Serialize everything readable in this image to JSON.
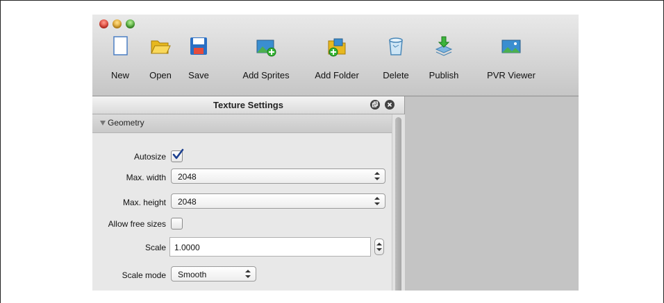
{
  "toolbar": {
    "buttons": [
      {
        "label": "New",
        "icon": "new-document-icon"
      },
      {
        "label": "Open",
        "icon": "folder-open-icon"
      },
      {
        "label": "Save",
        "icon": "floppy-disk-icon"
      },
      {
        "label": "Add Sprites",
        "icon": "add-sprites-icon"
      },
      {
        "label": "Add Folder",
        "icon": "add-folder-icon"
      },
      {
        "label": "Delete",
        "icon": "trash-icon"
      },
      {
        "label": "Publish",
        "icon": "publish-icon"
      },
      {
        "label": "PVR Viewer",
        "icon": "pvr-viewer-icon"
      }
    ]
  },
  "panel": {
    "title": "Texture Settings",
    "section": "Geometry",
    "autosize": {
      "label": "Autosize",
      "checked": true
    },
    "max_width": {
      "label": "Max. width",
      "value": "2048"
    },
    "max_height": {
      "label": "Max. height",
      "value": "2048"
    },
    "allow_free_sizes": {
      "label": "Allow free sizes",
      "checked": false
    },
    "scale": {
      "label": "Scale",
      "value": "1.0000"
    },
    "scale_mode": {
      "label": "Scale mode",
      "value": "Smooth"
    }
  }
}
